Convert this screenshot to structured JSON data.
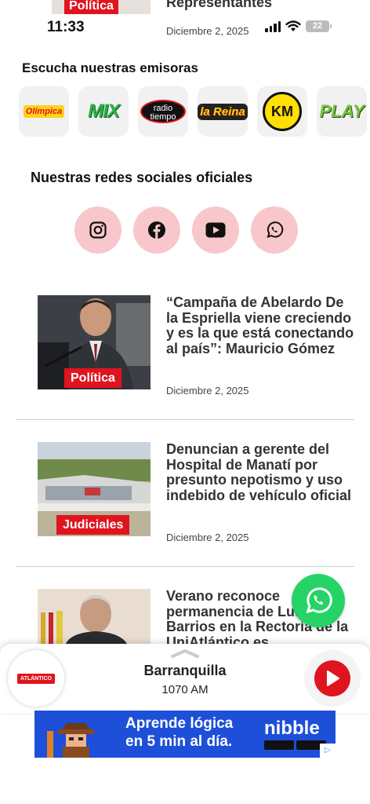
{
  "top_article": {
    "tag": "Política",
    "title": "Representantes"
  },
  "status": {
    "time": "11:33",
    "date": "Diciembre 2, 2025",
    "battery": "22"
  },
  "stations": {
    "title": "Escucha nuestras emisoras",
    "items": [
      {
        "label": "Olímpica"
      },
      {
        "label": "MIX"
      },
      {
        "label": "radio tiempo"
      },
      {
        "label": "la Reina"
      },
      {
        "label": "KM"
      },
      {
        "label": "PLAY"
      }
    ]
  },
  "social": {
    "title": "Nuestras redes sociales oficiales",
    "icons": [
      "instagram-icon",
      "facebook-icon",
      "youtube-icon",
      "whatsapp-icon"
    ]
  },
  "articles": [
    {
      "tag": "Política",
      "title": "“Campaña de Abelardo De la Espriella viene creciendo y es la que está conectando al país”: Mauricio Gómez",
      "date": "Diciembre 2, 2025"
    },
    {
      "tag": "Judiciales",
      "title": "Denuncian a gerente del Hospital de Manatí por presunto nepotismo y uso indebido de vehículo oficial",
      "date": "Diciembre 2, 2025"
    },
    {
      "tag": "",
      "title": "Verano reconoce permanencia de Luis Barrios en la Rectoría de la UniAtlántico es",
      "date": ""
    }
  ],
  "player": {
    "city": "Barranquilla",
    "frequency": "1070 AM",
    "logo_text": "ATLÁNTICO"
  },
  "ad": {
    "line1": "Aprende lógica",
    "line2": "en 5 min al día.",
    "brand": "nibble"
  },
  "colors": {
    "accent": "#e0141f",
    "social_bg": "#f8c7cb",
    "whatsapp": "#25d366",
    "ad_bg": "#1d4fd8"
  }
}
